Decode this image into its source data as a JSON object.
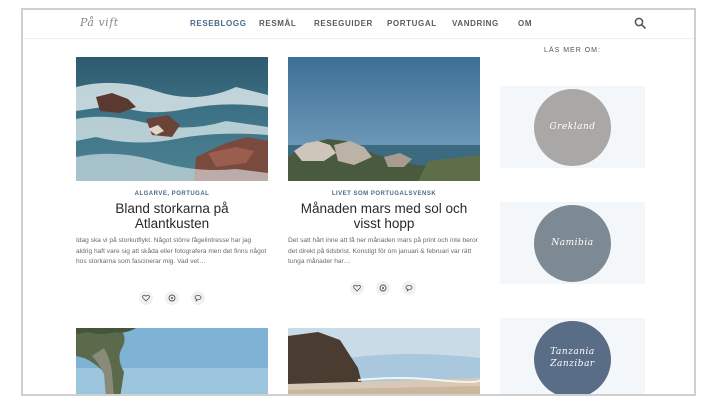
{
  "site": {
    "logo": "På vift"
  },
  "nav": {
    "items": [
      {
        "label": "RESEBLOGG",
        "active": true
      },
      {
        "label": "RESMÅL",
        "active": false
      },
      {
        "label": "RESEGUIDER",
        "active": false
      },
      {
        "label": "PORTUGAL",
        "active": false
      },
      {
        "label": "VANDRING",
        "active": false
      },
      {
        "label": "OM",
        "active": false
      }
    ],
    "search_icon": "search-icon"
  },
  "posts": [
    {
      "categories": "ALGARVE, PORTUGAL",
      "title_line1": "Bland storkarna på",
      "title_line2": "Atlantkusten",
      "excerpt": "Idag ska vi  på storkutflykt. Något större fågelintresse har jag aldrig haft vare sig att skåda eller fotografera men det finns något hos storkarna som fascinerar mig. Vad vet…"
    },
    {
      "categories": "LIVET SOM PORTUGALSVENSK",
      "title_line1": "Månaden mars med sol och",
      "title_line2": "visst hopp",
      "excerpt": "Det satt hårt inne att få ner månaden mars på print och inte beror det direkt på tidsbrist. Konstigt för om januari & februari var rätt tunga månader har…"
    }
  ],
  "sidebar": {
    "title": "LÄS MER OM:",
    "destinations": [
      {
        "label": "Grekland",
        "color": "#a9a8a6"
      },
      {
        "label": "Namibia",
        "color": "#7e8a93"
      },
      {
        "label_line1": "Tanzania",
        "label_line2": "Zanzibar",
        "color": "#5a6d86"
      }
    ]
  },
  "colors": {
    "accent": "#486a86"
  }
}
